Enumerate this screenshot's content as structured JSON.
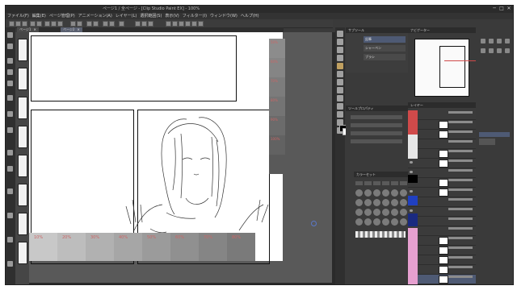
{
  "window": {
    "title": "ページ1 / 全ページ - [Clip Studio Paint EX] - 100%",
    "controls": [
      "─",
      "□",
      "✕"
    ]
  },
  "menu": {
    "items": [
      "ファイル(F)",
      "編集(E)",
      "ページ管理(P)",
      "アニメーション(A)",
      "レイヤー(L)",
      "選択範囲(S)",
      "表示(V)",
      "フィルター(I)",
      "ウィンドウ(W)",
      "ヘルプ(H)"
    ]
  },
  "tabs": {
    "items": [
      {
        "label": "ページ1"
      },
      {
        "label": "ページ2"
      }
    ],
    "close_glyph": "×"
  },
  "canvas": {
    "tone_labels": [
      "10%",
      "20%",
      "30%",
      "40%",
      "50%",
      "60%",
      "70%",
      "80%"
    ],
    "gray_labels": [
      "50%",
      "60%",
      "70%",
      "80%",
      "90%",
      "100%",
      "100%",
      "100%",
      "100%",
      "100%"
    ]
  },
  "subtool": {
    "header": "サブツール",
    "items": [
      "鉛筆",
      "シャーペン",
      "ブラシ"
    ]
  },
  "properties": {
    "header": "ツールプロパティ"
  },
  "colorset": {
    "header": "カラーセット"
  },
  "layer": {
    "header": "レイヤー"
  },
  "navigator": {
    "header": "ナビゲーター"
  },
  "colors": {
    "accent": "#5b78c8",
    "layer_red": "#d04a4a",
    "layer_blue": "#2040c0",
    "layer_pink": "#e6a0d0",
    "layer_darkblue": "#1a2a80"
  }
}
